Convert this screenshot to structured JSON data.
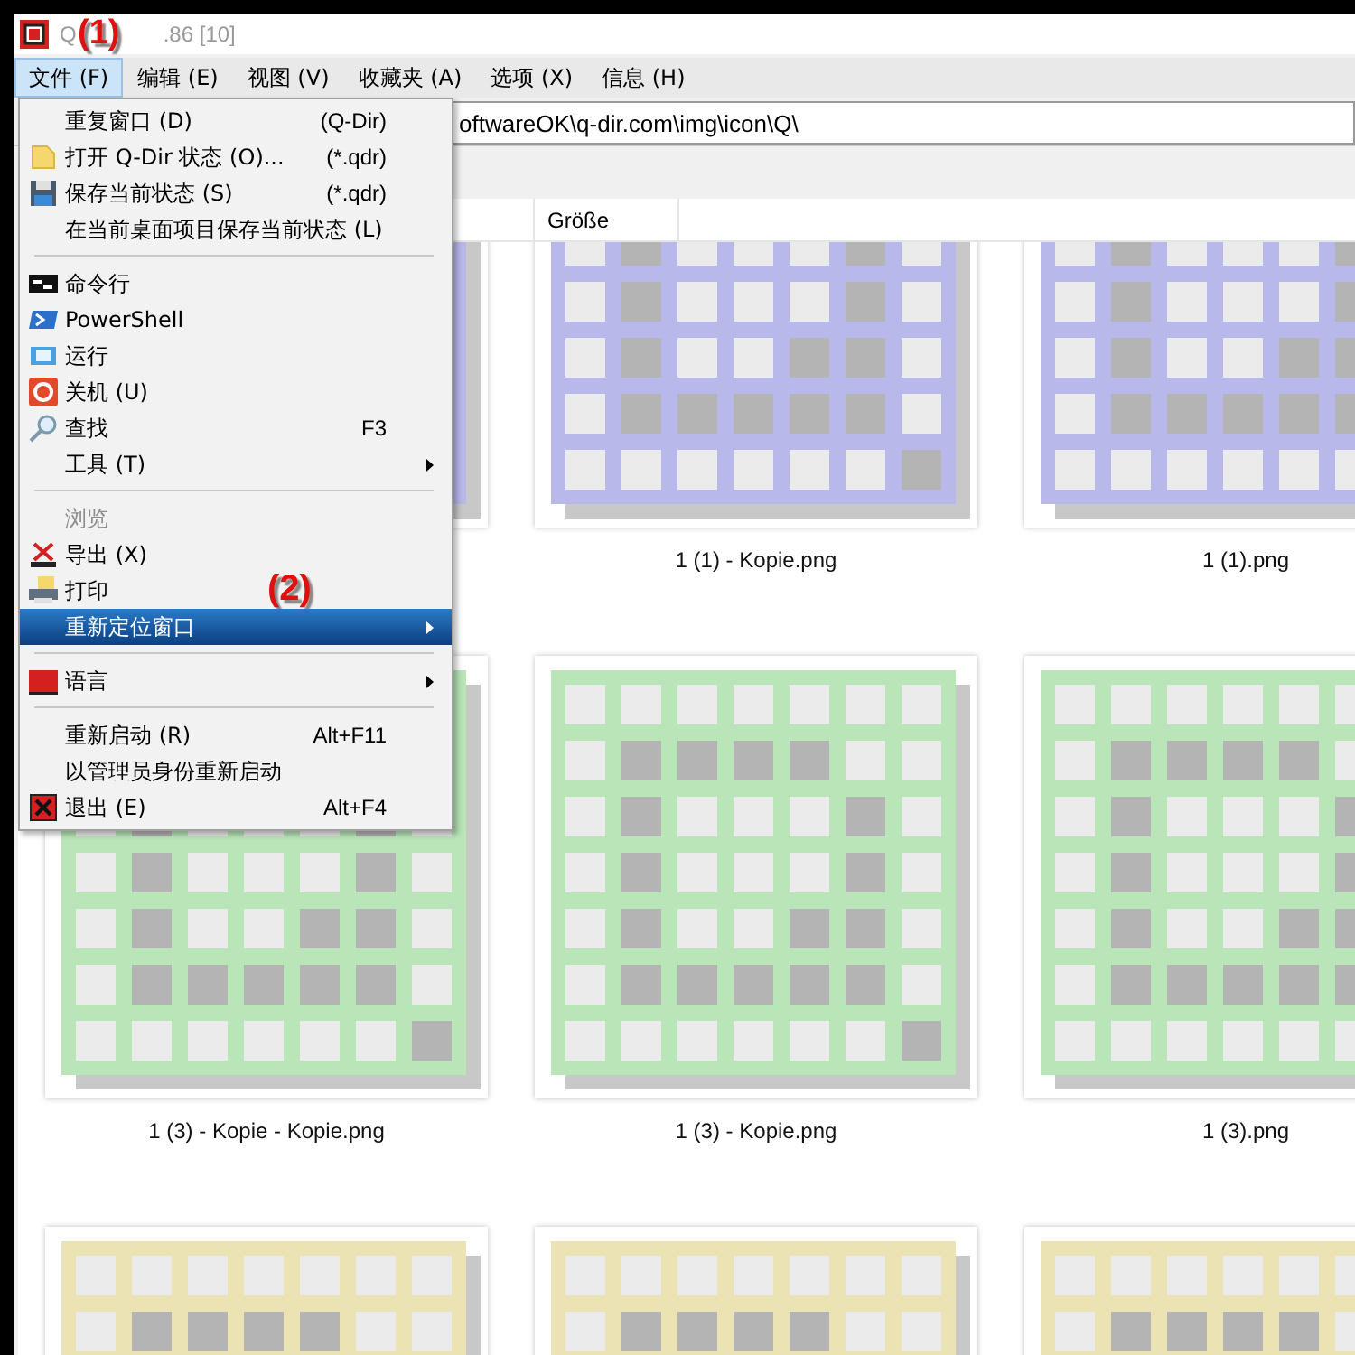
{
  "window": {
    "title_start": "Q",
    "title_end": ".86 [10]"
  },
  "annotations": [
    {
      "text": "(1)"
    },
    {
      "text": "(2)"
    }
  ],
  "menu_bar": [
    {
      "label": "文件 (F)",
      "selected": true
    },
    {
      "label": "编辑 (E)",
      "selected": false
    },
    {
      "label": "视图 (V)",
      "selected": false
    },
    {
      "label": "收藏夹 (A)",
      "selected": false
    },
    {
      "label": "选项 (X)",
      "selected": false
    },
    {
      "label": "信息 (H)",
      "selected": false
    }
  ],
  "address": {
    "value": "oftwareOK\\q-dir.com\\img\\icon\\Q\\"
  },
  "columns": [
    {
      "label": "Größe"
    }
  ],
  "thumbnails": [
    {
      "color": "#b9b8ea"
    },
    {
      "name": "1 (1) - Kopie.png",
      "color": "#b9b8ea"
    },
    {
      "name": "1 (1).png",
      "color": "#b9b8ea"
    },
    {
      "name": "1 (3) - Kopie - Kopie.png",
      "color": "#b9e5b8"
    },
    {
      "name": "1 (3) - Kopie.png",
      "color": "#b9e5b8"
    },
    {
      "name": "1 (3).png",
      "color": "#b9e5b8"
    },
    {
      "color": "#ebe3b4"
    },
    {
      "color": "#ebe3b4"
    },
    {
      "color": "#ebe3b4"
    }
  ],
  "menu": [
    {
      "kind": "item",
      "label": "重复窗口 (D)",
      "shortcut": "(Q-Dir)",
      "selected": false,
      "disabled": false,
      "submenu": false
    },
    {
      "kind": "item",
      "label": "打开 Q-Dir 状态 (O)...",
      "shortcut": "(*.qdr)",
      "selected": false,
      "disabled": false,
      "submenu": false
    },
    {
      "kind": "item",
      "label": "保存当前状态 (S)",
      "shortcut": "(*.qdr)",
      "selected": false,
      "disabled": false,
      "submenu": false
    },
    {
      "kind": "item",
      "label": "在当前桌面项目保存当前状态 (L)",
      "selected": false,
      "disabled": false,
      "submenu": false
    },
    {
      "kind": "separator"
    },
    {
      "kind": "item",
      "label": "命令行",
      "selected": false,
      "disabled": false,
      "submenu": false
    },
    {
      "kind": "item",
      "label": "PowerShell",
      "selected": false,
      "disabled": false,
      "submenu": false
    },
    {
      "kind": "item",
      "label": "运行",
      "selected": false,
      "disabled": false,
      "submenu": false
    },
    {
      "kind": "item",
      "label": "关机 (U)",
      "selected": false,
      "disabled": false,
      "submenu": false
    },
    {
      "kind": "item",
      "label": "查找",
      "shortcut": "F3",
      "selected": false,
      "disabled": false,
      "submenu": false
    },
    {
      "kind": "item",
      "label": "工具 (T)",
      "selected": false,
      "disabled": false,
      "submenu": true
    },
    {
      "kind": "separator"
    },
    {
      "kind": "item",
      "label": "浏览",
      "selected": false,
      "disabled": true,
      "submenu": false
    },
    {
      "kind": "item",
      "label": "导出 (X)",
      "selected": false,
      "disabled": false,
      "submenu": false
    },
    {
      "kind": "item",
      "label": "打印",
      "selected": false,
      "disabled": false,
      "submenu": false
    },
    {
      "kind": "item",
      "label": "重新定位窗口",
      "selected": true,
      "disabled": false,
      "submenu": true
    },
    {
      "kind": "separator"
    },
    {
      "kind": "item",
      "label": "语言",
      "selected": false,
      "disabled": false,
      "submenu": true
    },
    {
      "kind": "separator"
    },
    {
      "kind": "item",
      "label": "重新启动 (R)",
      "shortcut": "Alt+F11",
      "selected": false,
      "disabled": false,
      "submenu": false
    },
    {
      "kind": "item",
      "label": "以管理员身份重新启动",
      "selected": false,
      "disabled": false,
      "submenu": false
    },
    {
      "kind": "item",
      "label": "退出 (E)",
      "shortcut": "Alt+F4",
      "selected": false,
      "disabled": false,
      "submenu": false
    }
  ]
}
